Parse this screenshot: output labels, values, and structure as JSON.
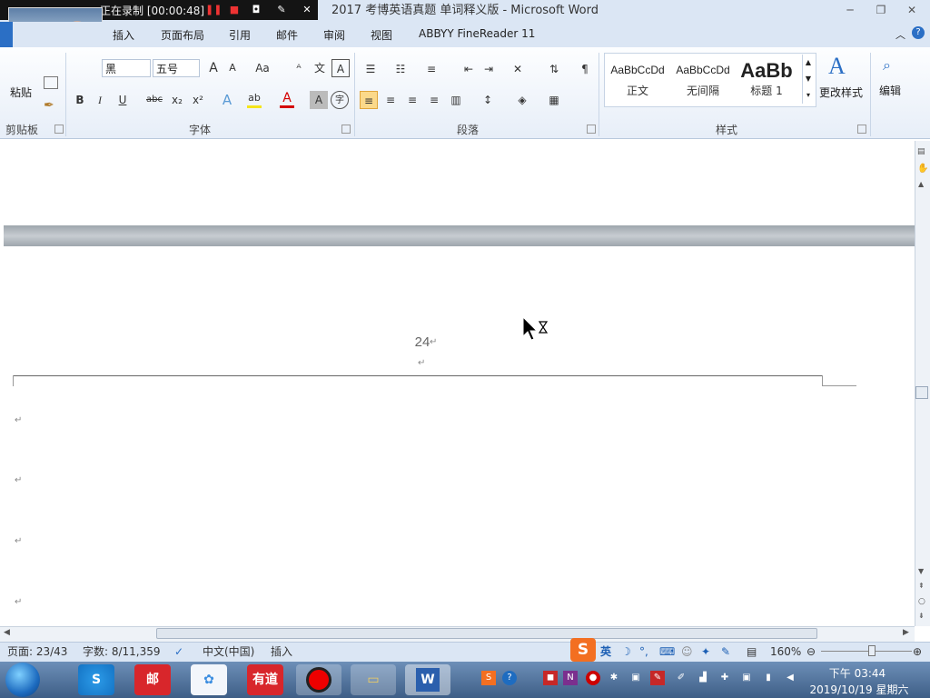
{
  "window": {
    "title": "2017 考博英语真题 单词释义版 - Microsoft Word",
    "minimize": "─",
    "restore": "❐",
    "close": "✕"
  },
  "recorder": {
    "status": "正在录制 [00:00:48]"
  },
  "tabs": [
    "插入",
    "页面布局",
    "引用",
    "邮件",
    "审阅",
    "视图",
    "ABBYY FineReader 11"
  ],
  "ribbon": {
    "clipboard": {
      "paste": "粘贴",
      "label": "剪贴板"
    },
    "font": {
      "font_name": "黑",
      "font_size": "五号",
      "grow": "A",
      "shrink": "A",
      "case": "Aa",
      "bold": "B",
      "italic": "I",
      "underline": "U",
      "strike": "abc",
      "subscript": "x₂",
      "superscript": "x²",
      "text_effect": "A",
      "highlight": "ab",
      "font_color": "A",
      "char_shading": "A",
      "enclose": "字",
      "label": "字体"
    },
    "paragraph": {
      "label": "段落"
    },
    "styles": {
      "items": [
        {
          "sample": "AaBbCcDd",
          "name": "正文"
        },
        {
          "sample": "AaBbCcDd",
          "name": "无间隔"
        },
        {
          "sample": "AaBb",
          "name": "标题 1"
        }
      ],
      "change_styles": "更改样式",
      "label": "样式"
    },
    "editing": {
      "label": "编辑"
    }
  },
  "document": {
    "page_number": "24",
    "para_mark": "↵"
  },
  "statusbar": {
    "page": "页面: 23/43",
    "words": "字数: 8/11,359",
    "language": "中文(中国)",
    "mode": "插入",
    "zoom": "160%"
  },
  "ime": {
    "logo": "S",
    "lang": "英"
  },
  "clock": {
    "time": "下午 03:44",
    "date": "2019/10/19 星期六"
  },
  "colors": {
    "accent": "#2b6fc5",
    "recorder_bg": "#141414",
    "font_color_bar": "#d40000",
    "highlight_bar": "#f5e51b"
  }
}
